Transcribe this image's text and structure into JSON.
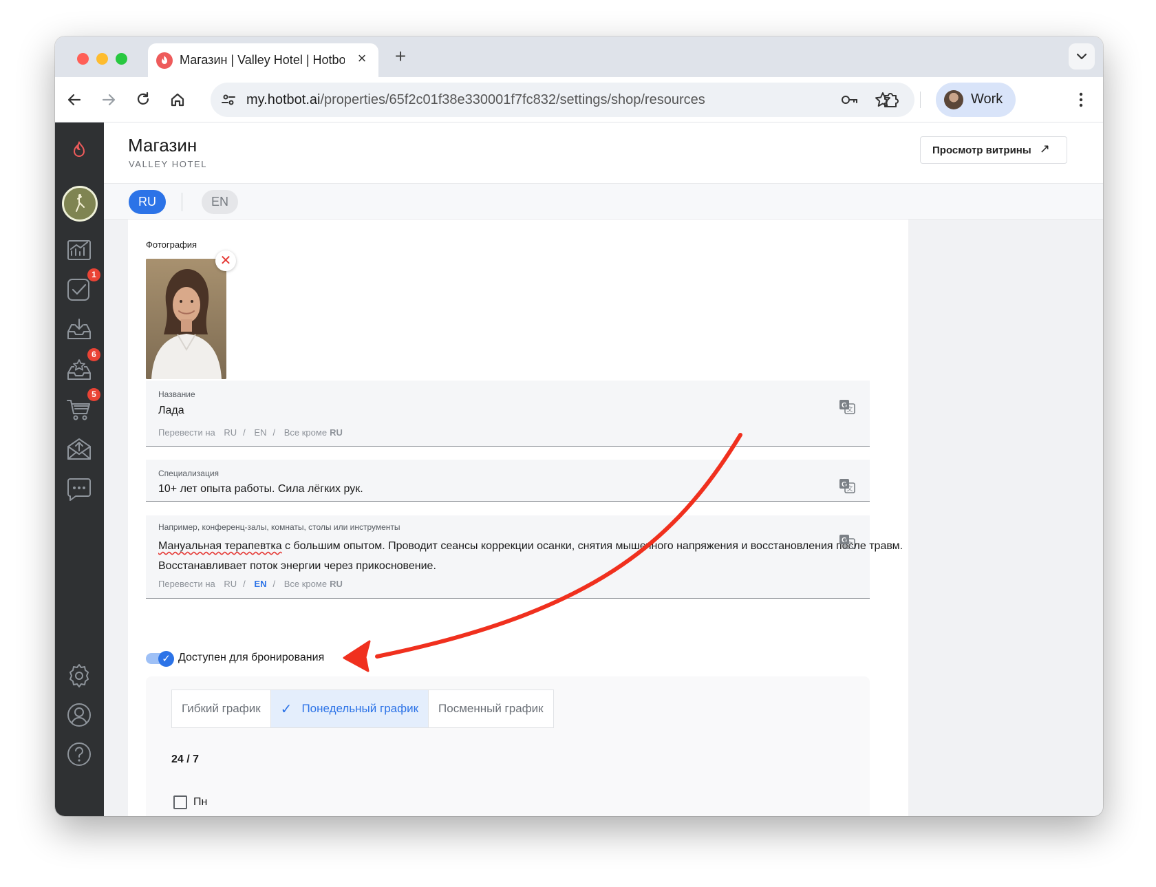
{
  "browser": {
    "tab_title": "Магазин | Valley Hotel | Hotbot",
    "url_host": "my.hotbot.ai",
    "url_path": "/properties/65f2c01f38e330001f7fc832/settings/shop/resources",
    "profile_label": "Work"
  },
  "sidebar": {
    "items": [
      {
        "icon": "analytics-icon",
        "badge": ""
      },
      {
        "icon": "tasks-icon",
        "badge": "1"
      },
      {
        "icon": "inbox-icon",
        "badge": ""
      },
      {
        "icon": "reviews-icon",
        "badge": "6"
      },
      {
        "icon": "cart-icon",
        "badge": "5"
      },
      {
        "icon": "mail-icon",
        "badge": ""
      },
      {
        "icon": "chat-icon",
        "badge": ""
      },
      {
        "icon": "settings-icon",
        "badge": ""
      },
      {
        "icon": "user-icon",
        "badge": ""
      },
      {
        "icon": "help-icon",
        "badge": ""
      }
    ]
  },
  "header": {
    "title": "Магазин",
    "subtitle": "VALLEY HOTEL",
    "storefront_button": "Просмотр витрины",
    "storefront_arrow": "↗"
  },
  "languages": {
    "active": "RU",
    "inactive": "EN"
  },
  "form": {
    "photo_label": "Фотография",
    "name": {
      "label": "Название",
      "value": "Лада",
      "translate_prefix": "Перевести на",
      "translate_ru": "RU",
      "translate_en": "EN",
      "translate_all": "Все кроме",
      "translate_all_lang": "RU"
    },
    "specialization": {
      "label": "Специализация",
      "value": "10+ лет опыта работы. Сила лёгких рук."
    },
    "description": {
      "label": "Например, конференц-залы, комнаты, столы или инструменты",
      "value_spell": "Мануальная терапевтка",
      "value_rest": " с большим опытом. Проводит сеансы коррекции осанки, снятия мышечного напряжения и восстановления после травм. Восстанавливает поток энергии через прикосновение.",
      "translate_prefix": "Перевести на",
      "translate_ru": "RU",
      "translate_en": "EN",
      "translate_all": "Все кроме",
      "translate_all_lang": "RU"
    },
    "booking_toggle": {
      "label": "Доступен для бронирования",
      "on": true
    },
    "schedule": {
      "options": [
        "Гибкий график",
        "Понедельный график",
        "Посменный график"
      ],
      "selected": "Понедельный график",
      "mode": "24 / 7",
      "day_label": "Пн",
      "day_checked": false
    }
  },
  "colors": {
    "accent": "#2c73e7",
    "sidebar": "#2f3133",
    "annotation_arrow": "#f0301e"
  }
}
